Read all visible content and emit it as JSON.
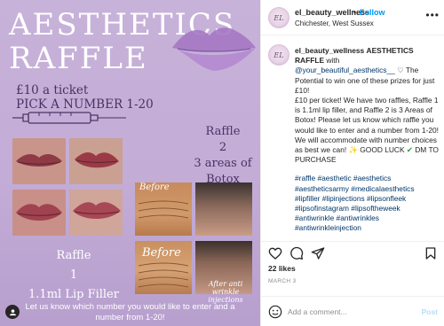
{
  "image": {
    "title_line1": "AESTHETICS",
    "title_line2": "RAFFLE",
    "price_line1": "£10 a ticket",
    "price_line2": "PICK A NUMBER 1-20",
    "raffle2_line1": "Raffle",
    "raffle2_line2": "2",
    "raffle2_line3": "3 areas of",
    "raffle2_line4": "Botox",
    "raffle1_line1": "Raffle",
    "raffle1_line2": "1",
    "raffle1_line3": "1.1ml Lip Filler",
    "before_label_1": "Before",
    "before_label_2": "Before",
    "after_label": "After anti wrinkle injections",
    "caption_overlay": "Let us know which number you would like to enter and a number from 1-20!",
    "bg_color": "#c5afd8",
    "text_dark": "#4a3264"
  },
  "header": {
    "username": "el_beauty_wellness",
    "separator": "•",
    "follow_label": "Follow",
    "location": "Chichester, West Sussex",
    "more_icon": "more-horizontal-icon",
    "avatar_monogram": "EL"
  },
  "caption": {
    "username": "el_beauty_wellness",
    "headline": "AESTHETICS RAFFLE",
    "with_text": "with",
    "mention": "@your_beautiful_aesthetics__",
    "heart_emoji": "♡",
    "line_potential": "The Potential to win one of these prizes for just £10!",
    "body": "£10 per ticket! We have two raffles, Raffle 1 is 1.1ml lip filler, and Raffle 2 is 3 Areas of Botox! Please let us know which raffle you would like to enter and a number from 1-20! We will accommodate with number choices as best we can!",
    "good_luck": "GOOD LUCK",
    "dm": "DM TO PURCHASE",
    "hashtags": "#raffle #aesthetic #aesthetics #aestheticsarmy #medicalaesthetics #lipfiller #lipinjections #lipsonfleek #lipsofinstagram #lipsoftheweek #antiwrinkle #antiwrinkles #antiwrinkleinjection"
  },
  "actions": {
    "like_icon": "heart-icon",
    "comment_icon": "comment-icon",
    "share_icon": "paper-plane-icon",
    "save_icon": "bookmark-icon"
  },
  "likes": "22 likes",
  "date": "MARCH 3",
  "comment": {
    "placeholder": "Add a comment...",
    "post_label": "Post"
  },
  "accent": "#0095f6"
}
